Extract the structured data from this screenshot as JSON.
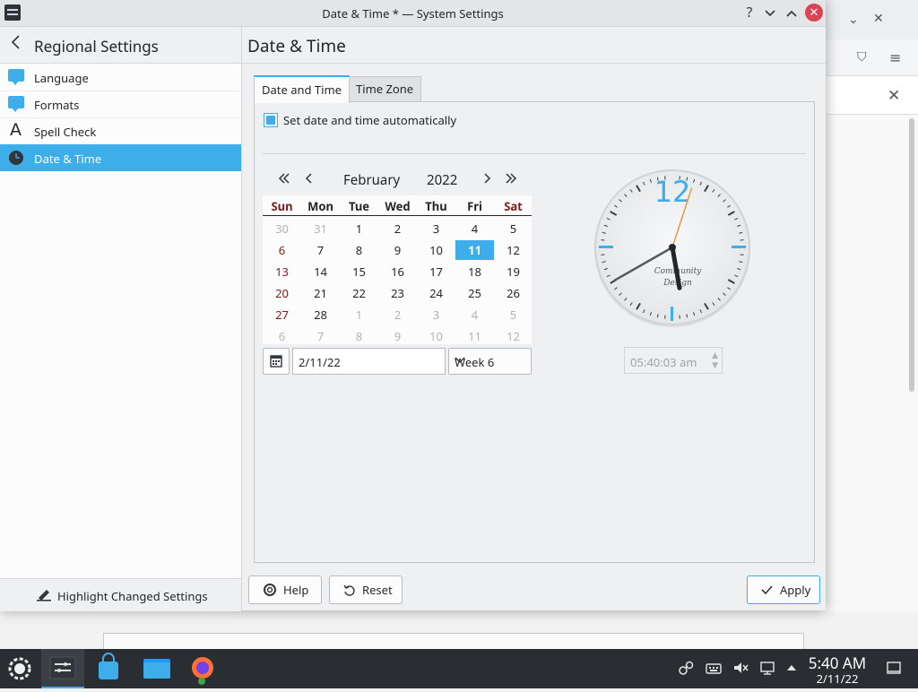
{
  "window": {
    "title": "Date & Time * — System Settings",
    "controls": {
      "help": "?",
      "minimize": "⌄",
      "maximize": "⌃",
      "close": "✕"
    }
  },
  "sidebar": {
    "back_label": "Regional Settings",
    "items": [
      {
        "label": "Language",
        "icon": "speech-bubble-icon"
      },
      {
        "label": "Formats",
        "icon": "speech-bubble-icon"
      },
      {
        "label": "Spell Check",
        "icon": "letter-a-icon"
      },
      {
        "label": "Date & Time",
        "icon": "clock-icon",
        "active": true
      }
    ],
    "footer_label": "Highlight Changed Settings"
  },
  "content": {
    "title": "Date & Time",
    "tabs": [
      {
        "label": "Date and Time",
        "active": true
      },
      {
        "label": "Time Zone",
        "active": false
      }
    ],
    "auto_checkbox": {
      "label": "Set date and time automatically",
      "checked": true
    }
  },
  "calendar": {
    "month": "February",
    "year": "2022",
    "day_headers": [
      "Sun",
      "Mon",
      "Tue",
      "Wed",
      "Thu",
      "Fri",
      "Sat"
    ],
    "weeks": [
      [
        "30",
        "31",
        "1",
        "2",
        "3",
        "4",
        "5"
      ],
      [
        "6",
        "7",
        "8",
        "9",
        "10",
        "11",
        "12"
      ],
      [
        "13",
        "14",
        "15",
        "16",
        "17",
        "18",
        "19"
      ],
      [
        "20",
        "21",
        "22",
        "23",
        "24",
        "25",
        "26"
      ],
      [
        "27",
        "28",
        "1",
        "2",
        "3",
        "4",
        "5"
      ],
      [
        "6",
        "7",
        "8",
        "9",
        "10",
        "11",
        "12"
      ]
    ],
    "selected_day": "11",
    "date_field": "2/11/22",
    "week_select": "Week 6"
  },
  "clock": {
    "numeral": "12",
    "brand_line1": "Community",
    "brand_line2": "Design",
    "time_field": "05:40:03 am",
    "hour": 5,
    "minute": 40,
    "second": 3
  },
  "buttons": {
    "help": "Help",
    "reset": "Reset",
    "apply": "Apply"
  },
  "taskbar": {
    "time": "5:40 AM",
    "date": "2/11/22"
  },
  "colors": {
    "accent": "#3daee9",
    "weekend": "#7a1d1d",
    "close": "#da4453"
  }
}
